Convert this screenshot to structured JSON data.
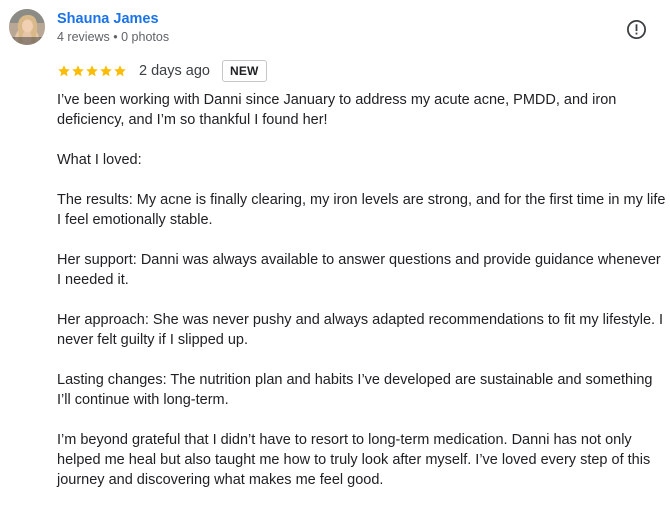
{
  "reviewer": {
    "name": "Shauna James",
    "meta": "4 reviews • 0 photos"
  },
  "rating": {
    "stars": 5,
    "max_stars": 5,
    "star_color": "#fbbc04",
    "date": "2 days ago",
    "badge": "NEW"
  },
  "report_icon": "exclamation-circle-icon",
  "colors": {
    "name_link": "#1a73e8",
    "text": "#202124",
    "meta": "#5f6368"
  },
  "review": {
    "paragraphs": [
      "I’ve been working with Danni since January to address my acute acne, PMDD, and iron deficiency, and I’m so thankful I found her!",
      "What I loved:",
      "The results: My acne is finally clearing, my iron levels are strong, and for the first time in my life I feel emotionally stable.",
      "Her support: Danni was always available to answer questions and provide guidance whenever I needed it.",
      "Her approach: She was never pushy and always adapted recommendations to fit my lifestyle. I never felt guilty if I slipped up.",
      "Lasting changes: The nutrition plan and habits I’ve developed are sustainable and something I’ll continue with long-term.",
      "I’m beyond grateful that I didn’t have to resort to long-term medication. Danni has not only helped me heal but also taught me how to truly look after myself. I’ve loved every step of this journey and discovering what makes me feel good."
    ]
  }
}
